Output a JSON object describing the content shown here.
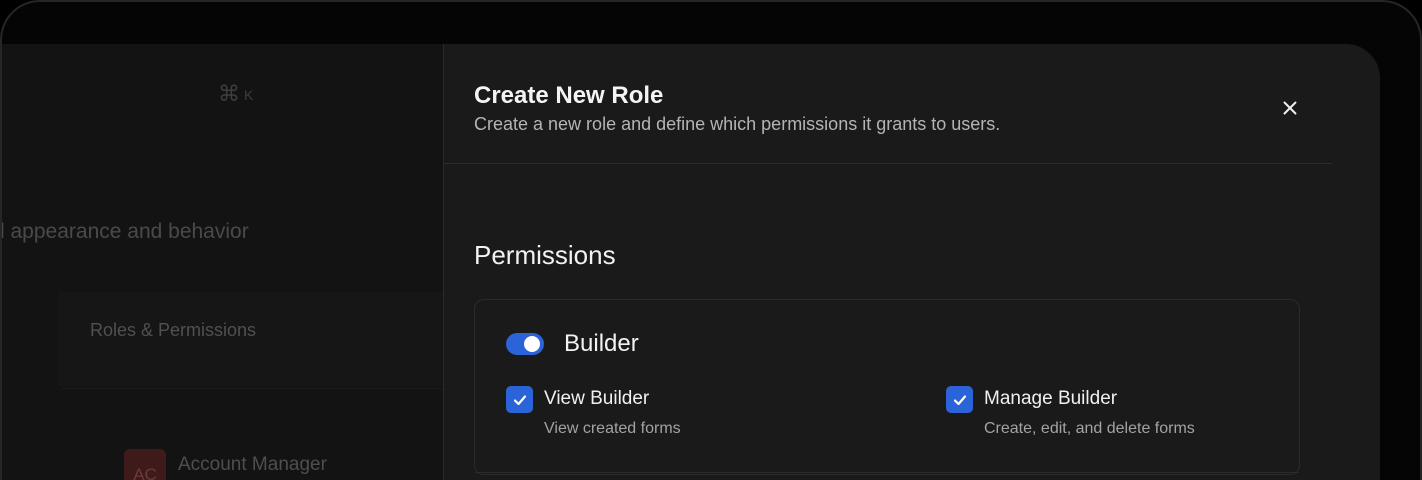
{
  "background_app": {
    "shortcut_symbol": "⌘",
    "shortcut_key": "K",
    "settings_description": "l appearance and behavior",
    "nav_item": "Roles & Permissions",
    "account": {
      "avatar_initials": "AC",
      "name": "Account Manager"
    }
  },
  "dialog": {
    "title": "Create New Role",
    "subtitle": "Create a new role and define which permissions it grants to users.",
    "close_icon": "close-icon",
    "section_title": "Permissions",
    "permission_group": {
      "label": "Builder",
      "enabled": true,
      "permissions": [
        {
          "name": "View Builder",
          "description": "View created forms",
          "checked": true
        },
        {
          "name": "Manage Builder",
          "description": "Create, edit, and delete forms",
          "checked": true
        }
      ]
    }
  },
  "colors": {
    "accent": "#2a64d8",
    "dialog_bg": "#1a1a1a",
    "text_primary": "#f2f2f2",
    "text_secondary": "#a3a3a3"
  }
}
